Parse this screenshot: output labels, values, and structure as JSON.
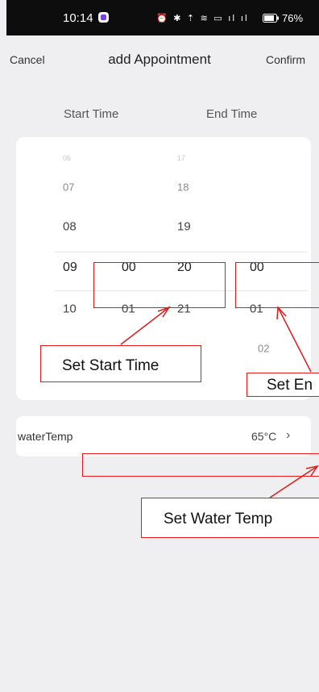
{
  "status_bar": {
    "time": "10:14",
    "icons_text": "⏰ ✱ ⇡ ≋ ▭ ıl ıl",
    "battery": "76%"
  },
  "header": {
    "cancel_label": "Cancel",
    "title": "add Appointment",
    "confirm_label": "Confirm"
  },
  "columns": {
    "start_label": "Start Time",
    "end_label": "End Time"
  },
  "picker": {
    "start_hours": [
      "06",
      "07",
      "08",
      "09",
      "10"
    ],
    "start_minutes": [
      "00",
      "01"
    ],
    "end_hours": [
      "17",
      "18",
      "19",
      "20",
      "21"
    ],
    "end_minutes": [
      "00",
      "01",
      "02"
    ],
    "selected": {
      "start_hour": "09",
      "start_minute": "00",
      "end_hour": "20",
      "end_minute": "00"
    }
  },
  "water_temp": {
    "label": "waterTemp",
    "value": "65°C"
  },
  "annotations": {
    "start_time": "Set Start Time",
    "end_time": "Set En",
    "water_temp": "Set Water Temp",
    "color": "#e31b1b"
  }
}
